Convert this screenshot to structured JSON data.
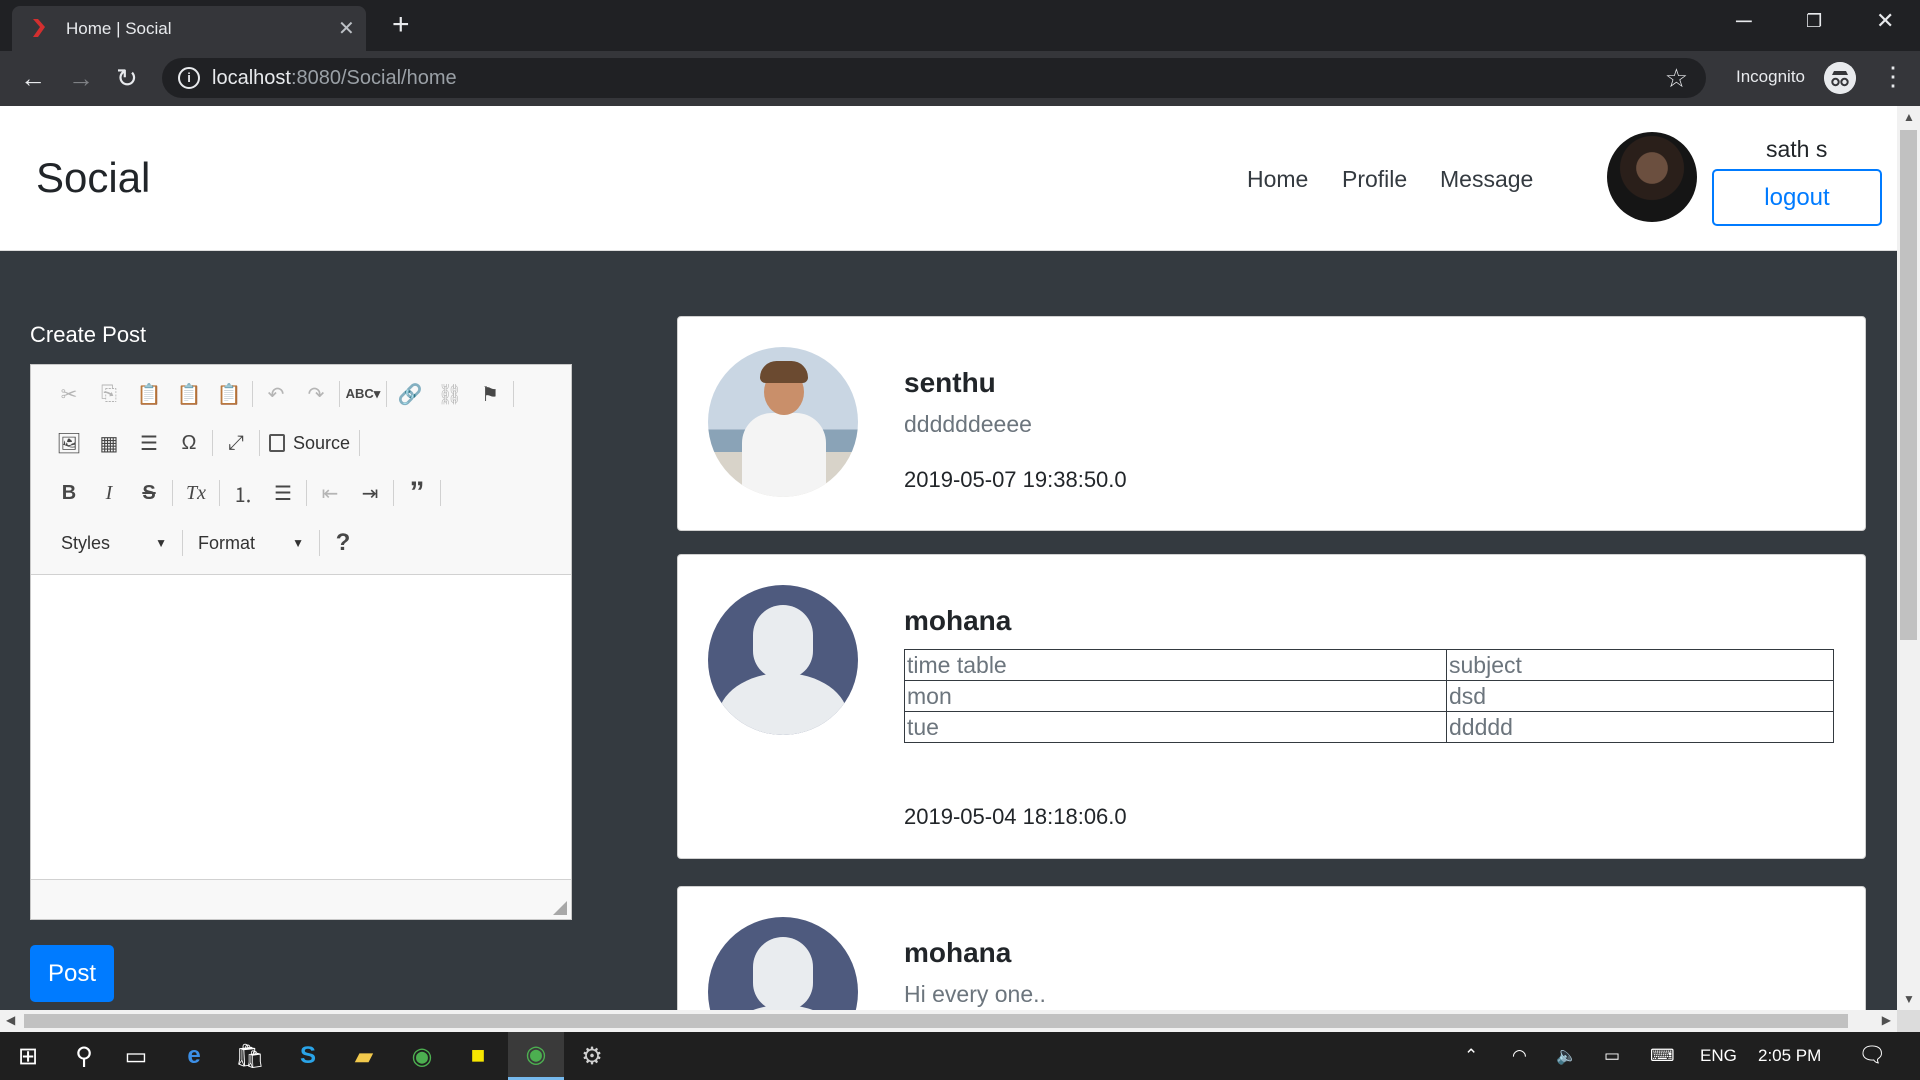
{
  "browser": {
    "tab_title": "Home | Social",
    "tab_close": "✕",
    "new_tab": "+",
    "url_host": "localhost",
    "url_path": ":8080/Social/home",
    "incognito_label": "Incognito",
    "window_controls": [
      "─",
      "❐",
      "✕"
    ]
  },
  "header": {
    "brand": "Social",
    "nav": [
      "Home",
      "Profile",
      "Message"
    ],
    "user_name": "sath s",
    "logout_label": "logout"
  },
  "create_post": {
    "title": "Create Post",
    "toolbar": {
      "source_label": "Source",
      "styles_label": "Styles",
      "format_label": "Format",
      "help_label": "?"
    },
    "post_button": "Post"
  },
  "posts": [
    {
      "author": "senthu",
      "content": "ddddddeeee",
      "timestamp": "2019-05-07 19:38:50.0",
      "avatar": "photo"
    },
    {
      "author": "mohana",
      "table": [
        [
          "time table",
          "subject"
        ],
        [
          "mon",
          "dsd"
        ],
        [
          "tue",
          "ddddd"
        ]
      ],
      "timestamp": "2019-05-04 18:18:06.0",
      "avatar": "default"
    },
    {
      "author": "mohana",
      "content": "Hi every one..",
      "avatar": "default"
    }
  ],
  "taskbar": {
    "language": "ENG",
    "time": "2:05 PM"
  },
  "colors": {
    "primary": "#007bff",
    "page_bg": "#343a40",
    "chrome_dark": "#202124",
    "chrome_tab": "#35363a"
  }
}
